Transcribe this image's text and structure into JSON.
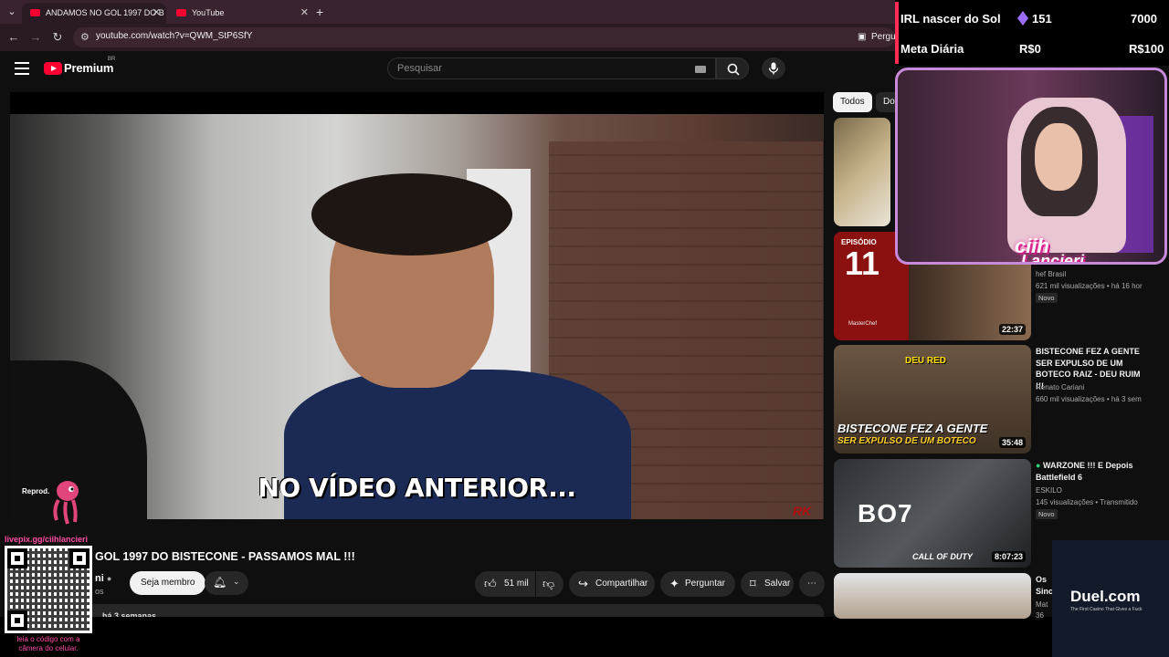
{
  "browser": {
    "tabs": [
      {
        "title": "ANDAMOS NO GOL 1997 DO B"
      },
      {
        "title": "YouTube"
      }
    ],
    "url": "youtube.com/watch?v=QWM_StP6SfY",
    "extension_label": "Pergu"
  },
  "youtube": {
    "logo_text": "Premium",
    "country": "BR",
    "search_placeholder": "Pesquisar"
  },
  "player": {
    "subtitle": "NO VÍDEO ANTERIOR...",
    "watermark": "RK"
  },
  "video": {
    "title": "GOL 1997 DO BISTECONE - PASSAMOS MAL !!!",
    "channel": "ni",
    "subs": "os",
    "member_label": "Seja membro",
    "likes": "51 mil",
    "share_label": "Compartilhar",
    "ask_label": "Perguntar",
    "save_label": "Salvar",
    "posted": "há 3 semanas"
  },
  "sidebar": {
    "chips": [
      "Todos",
      "Do"
    ],
    "recommendations": [
      {
        "title": "",
        "channel": "",
        "meta": "",
        "duration": ""
      },
      {
        "title": "",
        "channel": "hef Brasil",
        "meta": "621 mil visualizações • há 16 hor",
        "badge": "Novo",
        "duration": "22:37",
        "ep_label": "EPISÓDIO",
        "ep_num": "11",
        "brand": "MasterChef"
      },
      {
        "title": "BISTECONE FEZ A GENTE SER EXPULSO DE UM BOTECO RAIZ - DEU RUIM !!!",
        "channel": "Renato Cariani",
        "meta": "660 mil visualizações • há 3 sem",
        "duration": "35:48",
        "thumb_text1": "BISTECONE FEZ A GENTE",
        "thumb_text2": "SER EXPULSO DE UM BOTECO",
        "thumb_label": "DEU RED"
      },
      {
        "title": "WARZONE !!! E Depois Battlefield 6",
        "channel": "ESKILO",
        "meta": "145 visualizações • Transmitido",
        "badge": "Novo",
        "duration": "8:07:23",
        "thumb_text1": "BO7",
        "thumb_text2": "CALL OF DUTY"
      },
      {
        "title": "Os Sinc",
        "channel": "Mat",
        "meta": "36"
      }
    ]
  },
  "overlay": {
    "goal_title": "IRL nascer do Sol",
    "goal_count": "151",
    "goal_target": "7000",
    "meta_title": "Meta Diária",
    "meta_current": "R$0",
    "meta_target": "R$100",
    "streamer_name_1": "ciih",
    "streamer_name_2": "Lancieri",
    "reprod_label": "Reprod.",
    "livepix_url": "livepix.gg/ciihlancieri",
    "qr_caption": "leia o código com a câmera do celular.",
    "sponsor": "Duel.com",
    "sponsor_tagline": "The First Casino That Gives a Fuck"
  },
  "colors": {
    "accent": "#ff0033",
    "overlay_pink": "#ff4fa8",
    "cam_border": "#c78ad9"
  }
}
